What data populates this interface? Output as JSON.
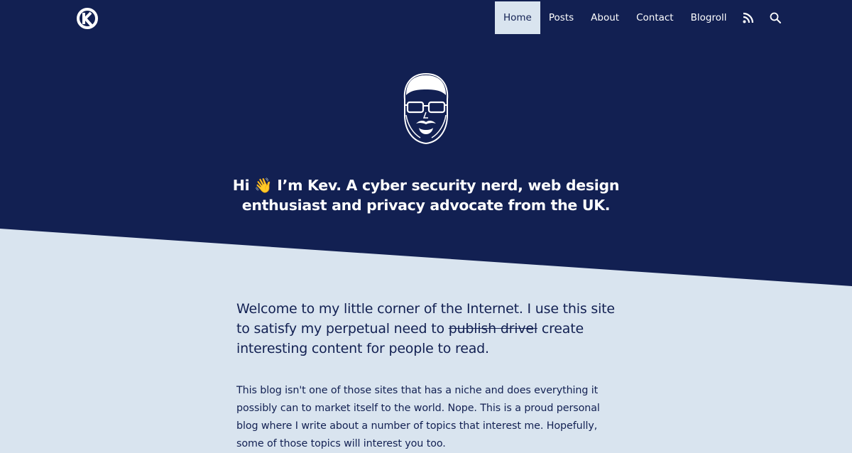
{
  "colors": {
    "navy": "#122052",
    "light": "#d9e4ef",
    "white": "#ffffff"
  },
  "nav": {
    "logo_icon": "k-logo-icon",
    "items": [
      {
        "label": "Home",
        "active": true
      },
      {
        "label": "Posts"
      },
      {
        "label": "About"
      },
      {
        "label": "Contact"
      },
      {
        "label": "Blogroll"
      }
    ],
    "rss_icon": "rss-icon",
    "search_icon": "search-icon"
  },
  "hero": {
    "avatar_icon": "bearded-face-avatar",
    "tagline_line1": "Hi 👋 I’m Kev. A cyber security nerd, web design",
    "tagline_line2": "enthusiast and privacy advocate from the UK."
  },
  "main": {
    "intro_before": "Welcome to my little corner of the Internet. I use this site to satisfy my perpetual need to ",
    "intro_struck": "publish drivel",
    "intro_after": " create interesting content for people to read.",
    "paragraph": "This blog isn't one of those sites that has a niche and does everything it possibly can to market itself to the world. Nope. This is a proud personal blog where I write about a number of topics that interest me. Hopefully, some of those topics will interest you too."
  }
}
